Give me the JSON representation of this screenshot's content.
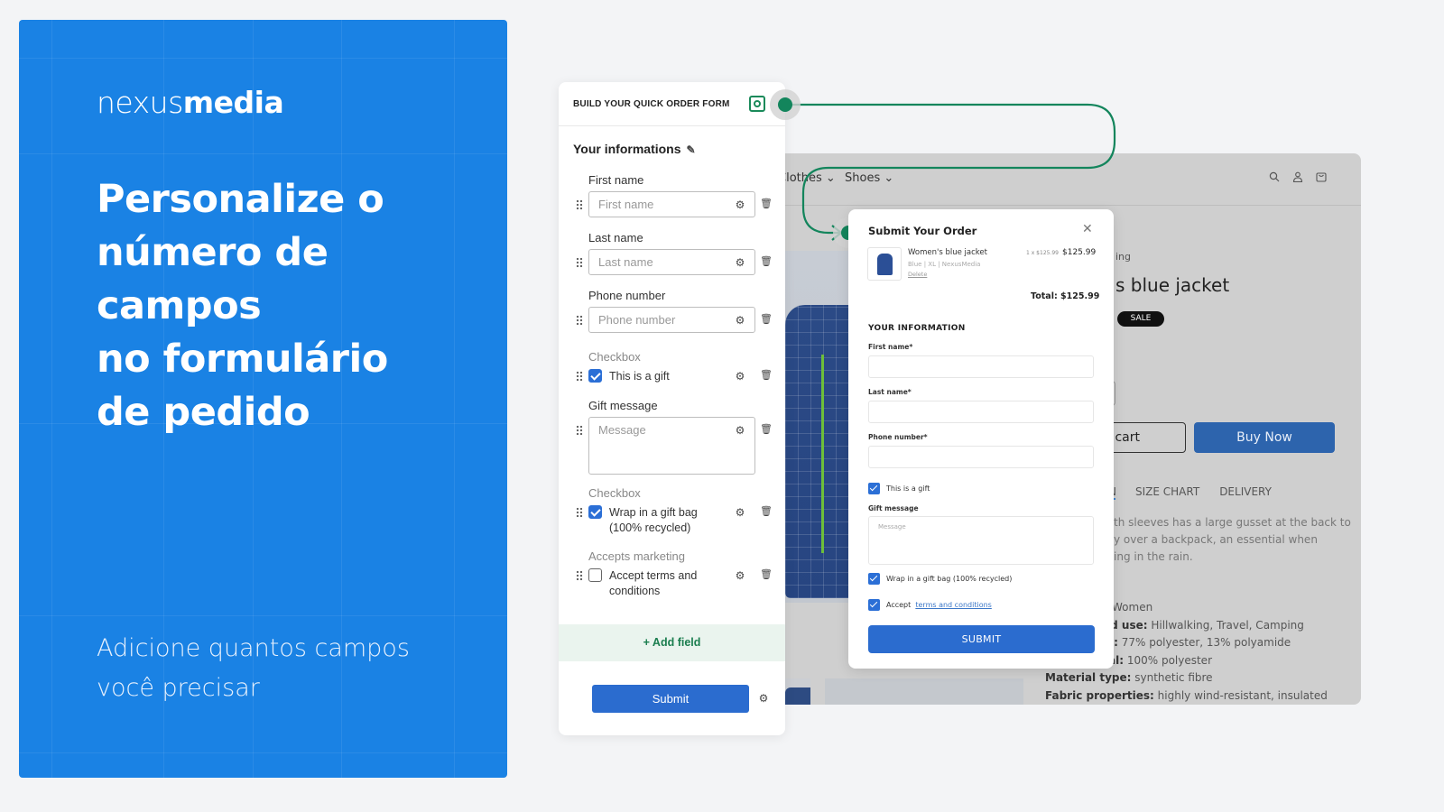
{
  "hero": {
    "logo_light": "nexus",
    "logo_bold": "media",
    "headline_lines": [
      "Personalize o",
      "número de campos",
      "no formulário",
      "de pedido"
    ],
    "subline_lines": [
      "Adicione quantos campos",
      "você precisar"
    ],
    "background_color": "#1a82e4"
  },
  "builder": {
    "title": "BUILD YOUR QUICK ORDER FORM",
    "preview_icon": "eye-preview-icon",
    "section_title": "Your informations",
    "section_edit_icon": "pencil-icon",
    "fields": [
      {
        "label": "First name",
        "type": "text",
        "placeholder": "First name"
      },
      {
        "label": "Last name",
        "type": "text",
        "placeholder": "Last name"
      },
      {
        "label": "Phone number",
        "type": "text",
        "placeholder": "Phone number"
      },
      {
        "label": "Checkbox",
        "type": "checkbox",
        "text": "This is a gift",
        "checked": true
      },
      {
        "label": "Gift message",
        "type": "textarea",
        "placeholder": "Message"
      },
      {
        "label": "Checkbox",
        "type": "checkbox",
        "text": "Wrap in a gift bag (100% recycled)",
        "checked": true
      },
      {
        "label": "Accepts marketing",
        "type": "checkbox",
        "text": "Accept terms and conditions",
        "checked": false
      }
    ],
    "add_field_label": "+ Add field",
    "submit_label": "Submit",
    "accent_color": "#1a7d4e"
  },
  "store": {
    "nav": [
      "Clothes",
      "Shoes"
    ],
    "nav_icons": [
      "search-icon",
      "account-icon",
      "cart-icon"
    ],
    "vendor_fragment": "ing",
    "product_title_fragment": "s blue jacket",
    "sale_badge": "SALE",
    "add_to_cart_fragment": "o cart",
    "buy_now": "Buy Now",
    "tabs": [
      "N",
      "SIZE CHART",
      "DELIVERY"
    ],
    "description_lines": [
      "th sleeves has a large gusset at the back to",
      "y over a backpack, an essential when",
      "ing in the rain."
    ],
    "specs": [
      {
        "key": "",
        "value": "Women"
      },
      {
        "key": "ed use:",
        "value": " Hillwalking, Travel, Camping"
      },
      {
        "key": "l:",
        "value": " 77% polyester, 13% polyamide"
      },
      {
        "key": "al:",
        "value": " 100% polyester"
      },
      {
        "key": "Material type:",
        "value": " synthetic fibre"
      },
      {
        "key": "Fabric properties:",
        "value": " highly wind-resistant, insulated"
      }
    ]
  },
  "modal": {
    "title": "Submit Your Order",
    "item": {
      "name": "Women's blue jacket",
      "meta": "Blue  |  XL  |  NexusMedia",
      "delete": "Delete",
      "unit": "1 x $125.99",
      "price": "$125.99"
    },
    "total": "Total: $125.99",
    "section": "YOUR INFORMATION",
    "fields": [
      {
        "label": "First name*",
        "value": ""
      },
      {
        "label": "Last name*",
        "value": ""
      },
      {
        "label": "Phone number*",
        "value": ""
      }
    ],
    "gift_checkbox": "This is a gift",
    "gift_message_label": "Gift message",
    "gift_message_placeholder": "Message",
    "wrap_checkbox": "Wrap in a gift bag (100% recycled)",
    "accept_prefix": "Accept",
    "accept_link": "terms and conditions",
    "submit": "SUBMIT"
  }
}
